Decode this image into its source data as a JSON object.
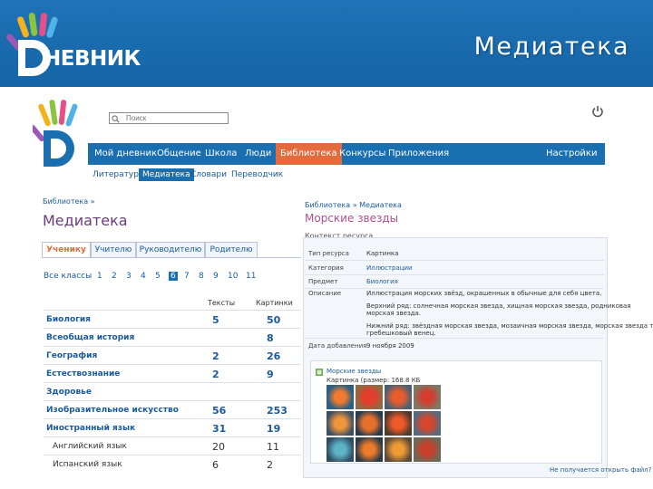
{
  "slide": {
    "logo_text": "НЕВНИК",
    "logo_letter": "D",
    "title": "Медиатека"
  },
  "app": {
    "search_placeholder": "Поиск",
    "nav": [
      "Мой дневник",
      "Общение",
      "Школа",
      "Люди",
      "Библиотека",
      "Конкурсы",
      "Приложения",
      "Настройки"
    ],
    "nav_active": "Библиотека",
    "subnav": [
      "Литература",
      "Медиатека",
      "Словари",
      "Переводчик"
    ],
    "subnav_active": "Медиатека"
  },
  "left": {
    "breadcrumb": "Библиотека »",
    "heading": "Медиатека",
    "tabs": [
      "Ученику",
      "Учителю",
      "Руководителю",
      "Родителю"
    ],
    "active_tab": "Ученику",
    "pager_label": "Все классы",
    "pages": [
      "1",
      "2",
      "3",
      "4",
      "5",
      "6",
      "7",
      "8",
      "9",
      "10",
      "11"
    ],
    "active_page": "6",
    "col_texts": "Тексты",
    "col_pictures": "Картинки",
    "rows": [
      {
        "name": "Биология",
        "texts": "5",
        "pictures": "50",
        "sub": false
      },
      {
        "name": "Всеобщая история",
        "texts": "",
        "pictures": "8",
        "sub": false
      },
      {
        "name": "География",
        "texts": "2",
        "pictures": "26",
        "sub": false
      },
      {
        "name": "Естествознание",
        "texts": "2",
        "pictures": "9",
        "sub": false
      },
      {
        "name": "Здоровье",
        "texts": "",
        "pictures": "",
        "sub": false
      },
      {
        "name": "Изобразительное искусство",
        "texts": "56",
        "pictures": "253",
        "sub": false
      },
      {
        "name": "Иностранный язык",
        "texts": "31",
        "pictures": "19",
        "sub": false
      },
      {
        "name": "Английский язык",
        "texts": "20",
        "pictures": "11",
        "sub": true
      },
      {
        "name": "Испанский язык",
        "texts": "6",
        "pictures": "2",
        "sub": true
      }
    ]
  },
  "right": {
    "breadcrumb": "Библиотека » Медиатека",
    "heading": "Морские звезды",
    "section_label": "Контекст ресурса",
    "fields": [
      {
        "key": "Тип ресурса",
        "value": "Картинка",
        "link": false
      },
      {
        "key": "Категория",
        "value": "Иллюстрации",
        "link": true
      },
      {
        "key": "Предмет",
        "value": "Биология",
        "link": true
      },
      {
        "key": "Описание",
        "value": "Иллюстрация морских звёзд, окрашенных в обычные для себя цвета.",
        "link": false
      }
    ],
    "desc_lines": [
      "Верхний ряд: солнечная морская звезда, хищная морская звезда, родниковая",
      "морская звезда.",
      "Нижний ряд: звёздная морская звезда, мозаичная морская звезда, морская звезда торка,",
      "гребешковый венец."
    ],
    "date_key": "Дата добавления",
    "date_value": "9 ноября 2009",
    "file_title": "Морские звезды",
    "file_meta": "Картинка (размер: 168.8 КБ",
    "download": "Не получается открыть файл?"
  },
  "colors": {
    "banner": "#1a6ab0",
    "nav": "#1a6fb0",
    "accent": "#e36b3c",
    "link": "#1a5a9a",
    "heading": "#6b3a7a"
  }
}
